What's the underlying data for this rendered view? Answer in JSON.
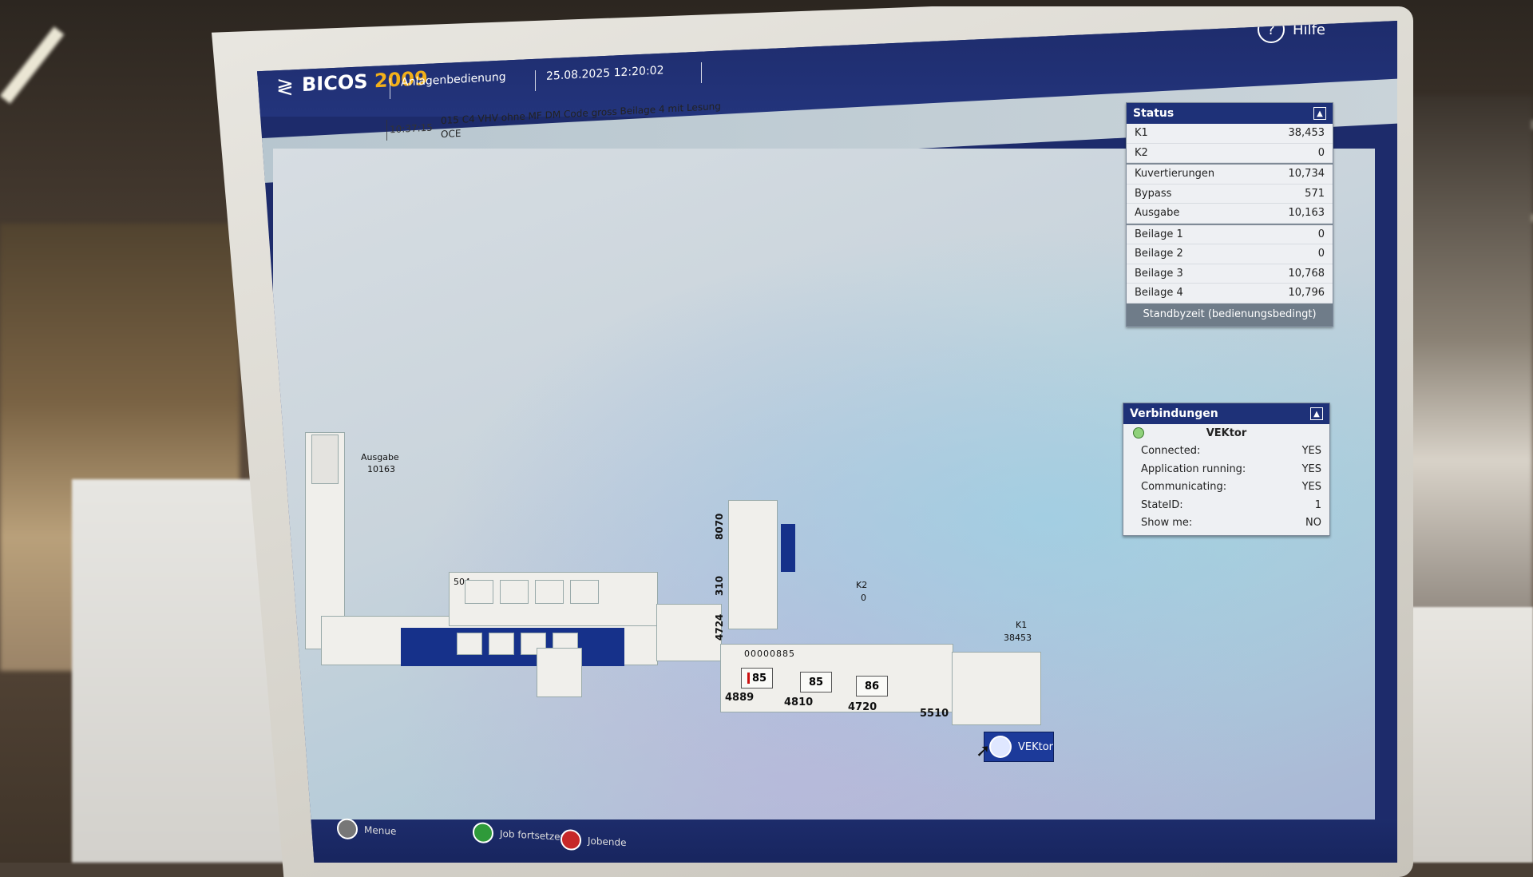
{
  "app": {
    "name": "BICOS",
    "year": "2009",
    "mode": "Anlagenbedienung",
    "datetime": "25.08.2025  12:20:02",
    "help_label": "Hilfe"
  },
  "message": {
    "time": "10:37:15",
    "line1": "015 C4 VHV ohne MF DM Code gross Beilage 4 mit Lesung",
    "line2": "OCE"
  },
  "layout_labels": {
    "ausgabe_title": "Ausgabe",
    "ausgabe_value": "10163",
    "station_504": "504",
    "v8070": "8070",
    "v310": "310",
    "v4724": "4724",
    "counter": "00000885",
    "k2_title": "K2",
    "k2_value": "0",
    "k1_title": "K1",
    "k1_value": "38453",
    "bins": [
      "85",
      "85",
      "86"
    ],
    "bin_counts": [
      "4889",
      "4810",
      "4720",
      "5510"
    ],
    "vektor_button": "VEKtor"
  },
  "status_panel": {
    "title": "Status",
    "groups": [
      [
        {
          "label": "K1",
          "value": "38,453"
        },
        {
          "label": "K2",
          "value": "0"
        }
      ],
      [
        {
          "label": "Kuvertierungen",
          "value": "10,734"
        },
        {
          "label": "Bypass",
          "value": "571"
        },
        {
          "label": "Ausgabe",
          "value": "10,163"
        }
      ],
      [
        {
          "label": "Beilage 1",
          "value": "0"
        },
        {
          "label": "Beilage 2",
          "value": "0"
        },
        {
          "label": "Beilage 3",
          "value": "10,768"
        },
        {
          "label": "Beilage 4",
          "value": "10,796"
        }
      ]
    ],
    "footer": "Standbyzeit (bedienungsbedingt)"
  },
  "connections_panel": {
    "title": "Verbindungen",
    "name": "VEKtor",
    "rows": [
      {
        "label": "Connected:",
        "value": "YES"
      },
      {
        "label": "Application running:",
        "value": "YES"
      },
      {
        "label": "Communicating:",
        "value": "YES"
      },
      {
        "label": "StateID:",
        "value": "1"
      },
      {
        "label": "Show me:",
        "value": "NO"
      }
    ]
  },
  "bottom": {
    "menu": "Menue",
    "continue": "Job fortsetzen",
    "end": "Jobende"
  },
  "colors": {
    "header": "#1e2c6c",
    "accent": "#f2b01a",
    "machine_blue": "#16318a",
    "led_green": "#8fd17a",
    "continue_green": "#2f9a3a",
    "end_red": "#c62828"
  }
}
